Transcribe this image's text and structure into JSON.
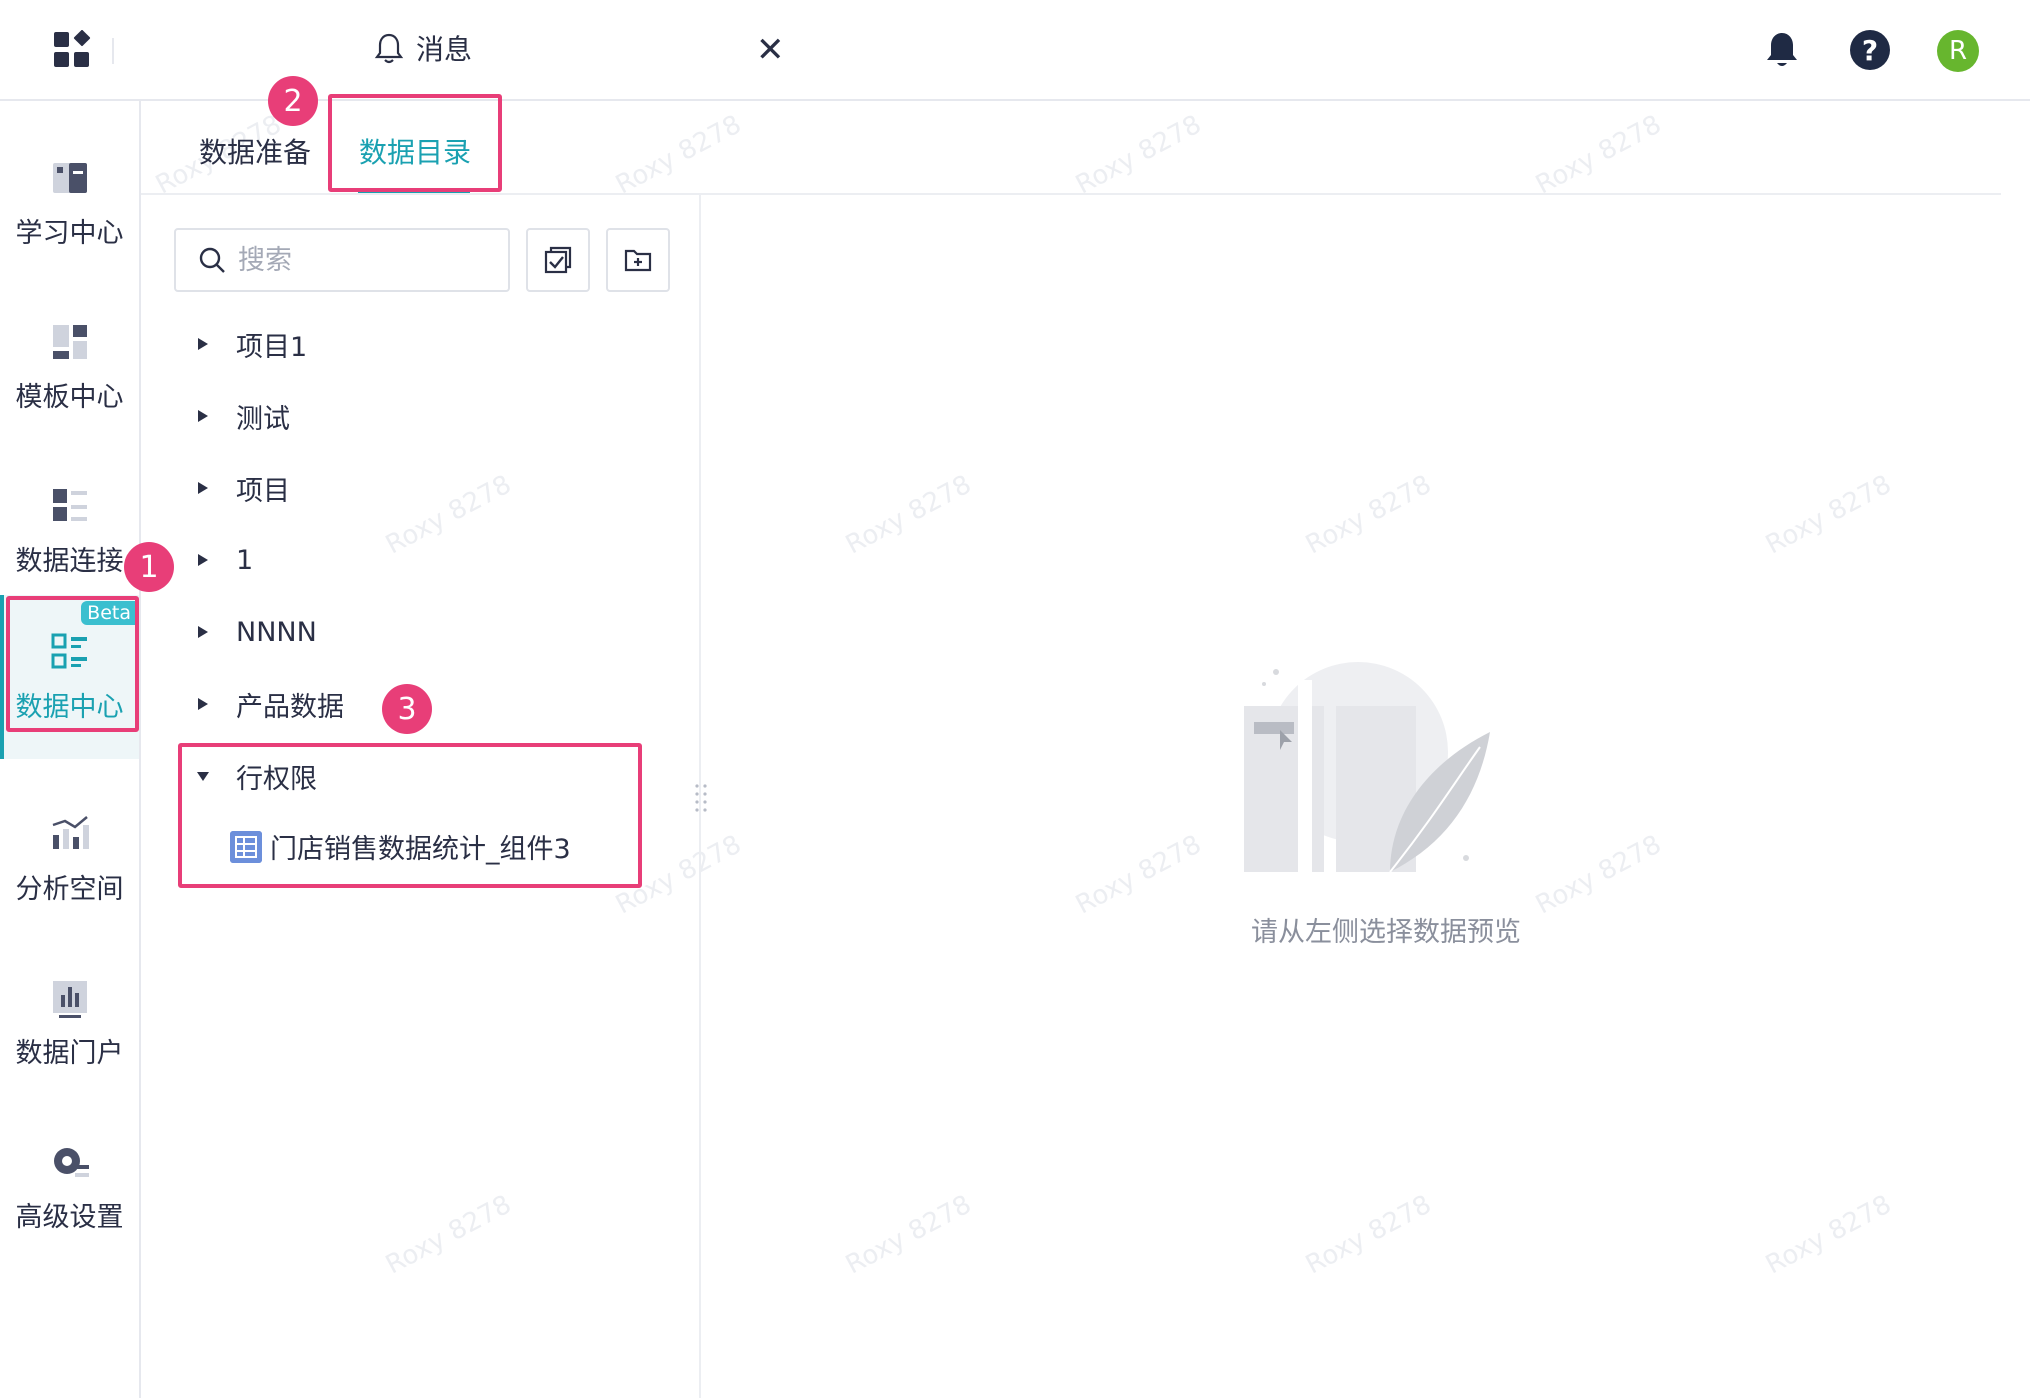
{
  "topbar": {
    "msg_tab_label": "消息",
    "close_symbol": "✕",
    "help_symbol": "?",
    "avatar_initial": "R"
  },
  "sidebar": {
    "items": [
      {
        "label": "学习中心",
        "icon": "book-icon"
      },
      {
        "label": "模板中心",
        "icon": "template-icon"
      },
      {
        "label": "数据连接",
        "icon": "data-connection-icon"
      },
      {
        "label": "数据中心",
        "icon": "data-center-icon",
        "badge": "Beta",
        "active": true
      },
      {
        "label": "分析空间",
        "icon": "analysis-icon"
      },
      {
        "label": "数据门户",
        "icon": "bar-chart-icon"
      },
      {
        "label": "高级设置",
        "icon": "settings-icon"
      }
    ]
  },
  "tabs": [
    {
      "label": "数据准备"
    },
    {
      "label": "数据目录",
      "active": true
    }
  ],
  "search": {
    "placeholder": "搜索"
  },
  "tree": {
    "items": [
      {
        "label": "项目1",
        "expanded": false
      },
      {
        "label": "测试",
        "expanded": false
      },
      {
        "label": "项目",
        "expanded": false
      },
      {
        "label": "1",
        "expanded": false
      },
      {
        "label": "NNNN",
        "expanded": false
      },
      {
        "label": "产品数据",
        "expanded": false
      },
      {
        "label": "行权限",
        "expanded": true
      }
    ],
    "leaf": {
      "label": "门店销售数据统计_组件3"
    }
  },
  "empty_state": {
    "text": "请从左侧选择数据预览"
  },
  "annotations": {
    "badge1": "1",
    "badge2": "2",
    "badge3": "3"
  },
  "watermark": "Roxy 8278",
  "colors": {
    "accent": "#1aa1b1",
    "highlight": "#e83e78",
    "avatar": "#67b62e"
  }
}
